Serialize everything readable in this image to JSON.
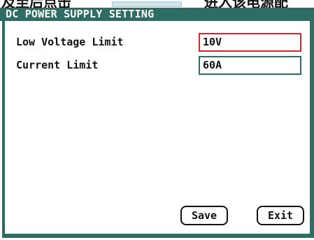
{
  "background_strip": {
    "left_text": "及至后点击",
    "right_text": "进入该电源配"
  },
  "window": {
    "title": "DC POWER SUPPLY SETTING"
  },
  "settings": [
    {
      "label": "Low Voltage Limit",
      "value": "10V"
    },
    {
      "label": "Current Limit",
      "value": "60A"
    }
  ],
  "buttons": {
    "save_label": "Save",
    "exit_label": "Exit"
  },
  "colors": {
    "frame": "#2e6d63",
    "active_field_border": "#d9262d",
    "text": "#111111"
  }
}
